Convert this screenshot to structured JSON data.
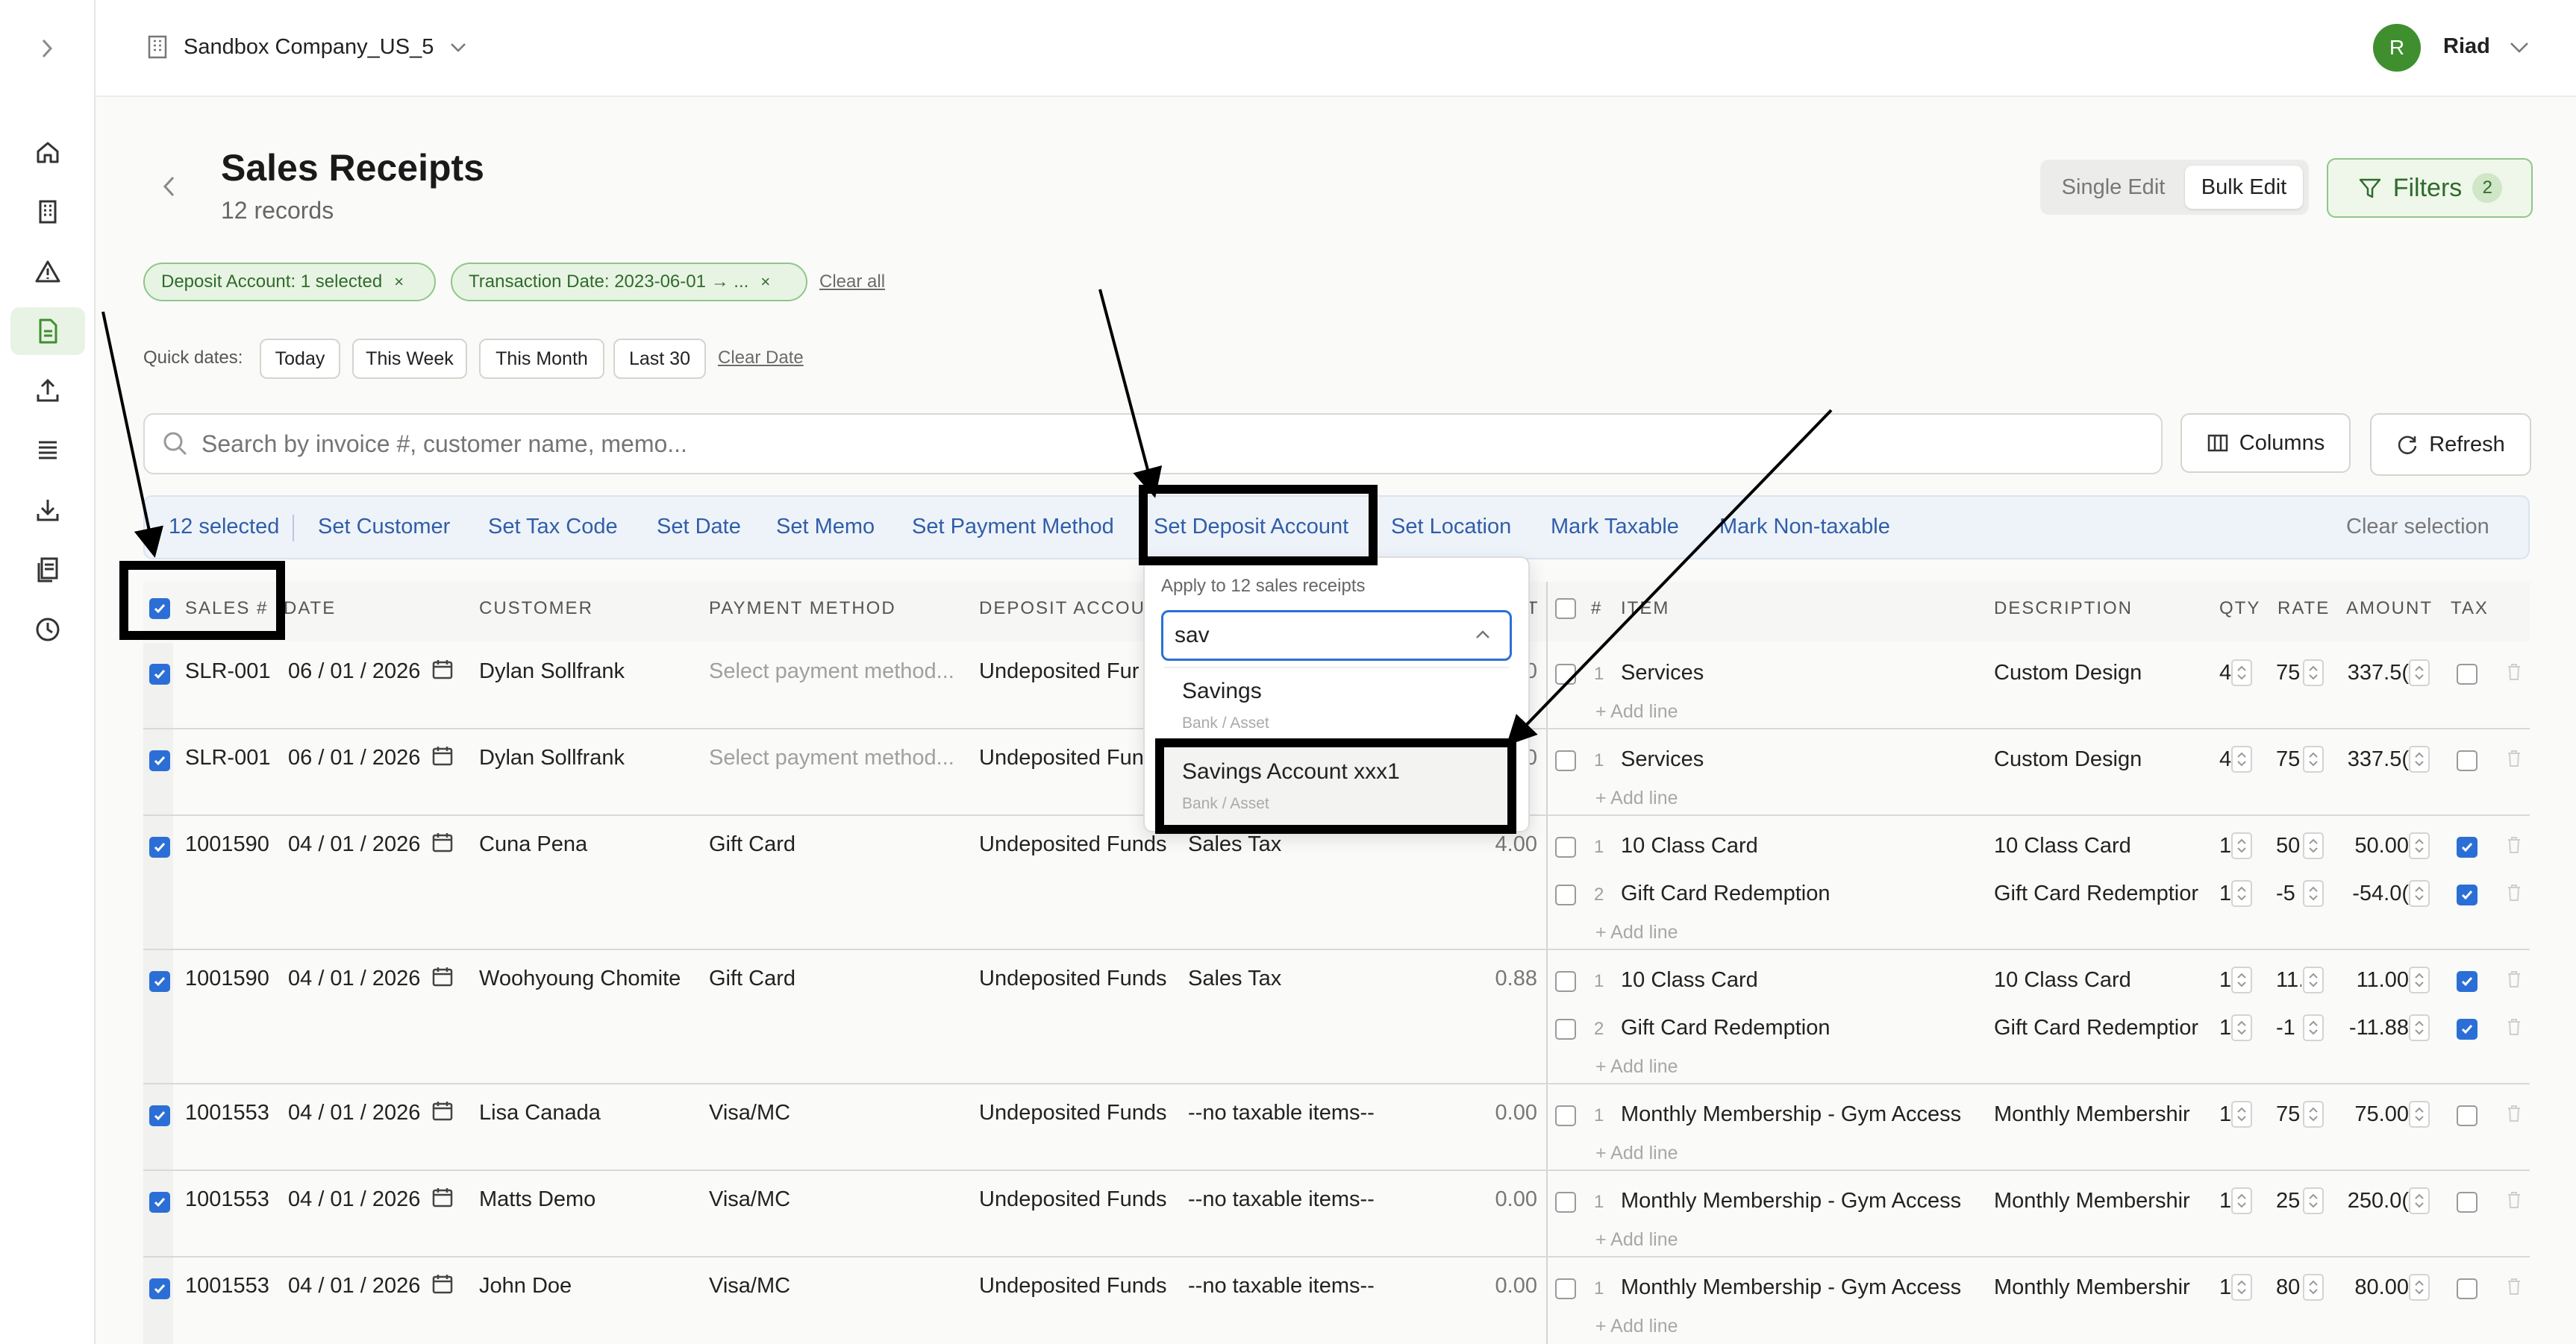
{
  "company": {
    "name": "Sandbox Company_US_5"
  },
  "user": {
    "initial": "R",
    "name": "Riad",
    "avatar_color": "#3f8f2f"
  },
  "page": {
    "title": "Sales Receipts",
    "subtitle": "12 records"
  },
  "view_toggle": {
    "single": "Single Edit",
    "bulk": "Bulk Edit",
    "active": "Bulk Edit"
  },
  "filters_button": {
    "label": "Filters",
    "count": "2"
  },
  "filter_chips": [
    {
      "label": "Deposit Account: 1 selected",
      "close": "×"
    },
    {
      "label": "Transaction Date: 2023-06-01 → ...",
      "close": "×"
    }
  ],
  "clear_all": "Clear all",
  "quick_dates": {
    "label": "Quick dates:",
    "options": [
      "Today",
      "This Week",
      "This Month",
      "Last 30"
    ],
    "clear": "Clear Date"
  },
  "search": {
    "placeholder": "Search by invoice #, customer name, memo..."
  },
  "toolbar": {
    "columns": "Columns",
    "refresh": "Refresh"
  },
  "bulk_actions": {
    "selected": "12 selected",
    "actions": [
      "Set Customer",
      "Set Tax Code",
      "Set Date",
      "Set Memo",
      "Set Payment Method",
      "Set Deposit Account",
      "Set Location",
      "Mark Taxable",
      "Mark Non-taxable"
    ],
    "clear": "Clear selection"
  },
  "columns": {
    "sales_no": "SALES #",
    "date": "DATE",
    "customer": "CUSTOMER",
    "payment_method": "PAYMENT METHOD",
    "deposit_account": "DEPOSIT ACCOUI",
    "tax_trunc": "T",
    "line_no": "#",
    "item": "ITEM",
    "description": "DESCRIPTION",
    "qty": "QTY",
    "rate": "RATE",
    "amount": "AMOUNT",
    "tax": "TAX"
  },
  "dropdown": {
    "apply_text": "Apply to 12 sales receipts",
    "input_value": "sav",
    "options": [
      {
        "name": "Savings",
        "type": "Bank / Asset"
      },
      {
        "name": "Savings Account xxx1",
        "type": "Bank / Asset"
      }
    ]
  },
  "add_line": "+ Add line",
  "rows": [
    {
      "no": "SLR-001",
      "date": "06 / 01 / 2026",
      "customer": "Dylan Sollfrank",
      "payment": "Select payment method...",
      "deposit": "Undeposited Fur",
      "tax_name": "",
      "tax_amt": "0",
      "lines": [
        {
          "n": "1",
          "item": "Services",
          "desc": "Custom Design",
          "qty": "4",
          "rate": "75",
          "amount": "337.5(",
          "tax": false
        }
      ]
    },
    {
      "no": "SLR-001",
      "date": "06 / 01 / 2026",
      "customer": "Dylan Sollfrank",
      "payment": "Select payment method...",
      "deposit": "Undeposited Func",
      "tax_name": "",
      "tax_amt": "00",
      "lines": [
        {
          "n": "1",
          "item": "Services",
          "desc": "Custom Design",
          "qty": "4",
          "rate": "75",
          "amount": "337.5(",
          "tax": false
        }
      ]
    },
    {
      "no": "1001590",
      "date": "04 / 01 / 2026",
      "customer": "Cuna Pena",
      "payment": "Gift Card",
      "deposit": "Undeposited Funds",
      "tax_name": "Sales Tax",
      "tax_amt": "4.00",
      "lines": [
        {
          "n": "1",
          "item": "10 Class Card",
          "desc": "10 Class Card",
          "qty": "1",
          "rate": "50",
          "amount": "50.00",
          "tax": true
        },
        {
          "n": "2",
          "item": "Gift Card Redemption",
          "desc": "Gift Card Redemptior",
          "qty": "1",
          "rate": "-5",
          "amount": "-54.0(",
          "tax": true
        }
      ]
    },
    {
      "no": "1001590",
      "date": "04 / 01 / 2026",
      "customer": "Woohyoung Chomite",
      "payment": "Gift Card",
      "deposit": "Undeposited Funds",
      "tax_name": "Sales Tax",
      "tax_amt": "0.88",
      "lines": [
        {
          "n": "1",
          "item": "10 Class Card",
          "desc": "10 Class Card",
          "qty": "1",
          "rate": "11.",
          "amount": "11.00",
          "tax": true
        },
        {
          "n": "2",
          "item": "Gift Card Redemption",
          "desc": "Gift Card Redemptior",
          "qty": "1",
          "rate": "-1",
          "amount": "-11.88",
          "tax": true
        }
      ]
    },
    {
      "no": "1001553",
      "date": "04 / 01 / 2026",
      "customer": "Lisa Canada",
      "payment": "Visa/MC",
      "deposit": "Undeposited Funds",
      "tax_name": "--no taxable items--",
      "tax_amt": "0.00",
      "lines": [
        {
          "n": "1",
          "item": "Monthly Membership - Gym Access",
          "desc": "Monthly Membershir",
          "qty": "1",
          "rate": "75",
          "amount": "75.00",
          "tax": false
        }
      ]
    },
    {
      "no": "1001553",
      "date": "04 / 01 / 2026",
      "customer": "Matts Demo",
      "payment": "Visa/MC",
      "deposit": "Undeposited Funds",
      "tax_name": "--no taxable items--",
      "tax_amt": "0.00",
      "lines": [
        {
          "n": "1",
          "item": "Monthly Membership - Gym Access",
          "desc": "Monthly Membershir",
          "qty": "1",
          "rate": "25",
          "amount": "250.0(",
          "tax": false
        }
      ]
    },
    {
      "no": "1001553",
      "date": "04 / 01 / 2026",
      "customer": "John Doe",
      "payment": "Visa/MC",
      "deposit": "Undeposited Funds",
      "tax_name": "--no taxable items--",
      "tax_amt": "0.00",
      "lines": [
        {
          "n": "1",
          "item": "Monthly Membership - Gym Access",
          "desc": "Monthly Membershir",
          "qty": "1",
          "rate": "80",
          "amount": "80.00",
          "tax": false
        }
      ]
    }
  ]
}
